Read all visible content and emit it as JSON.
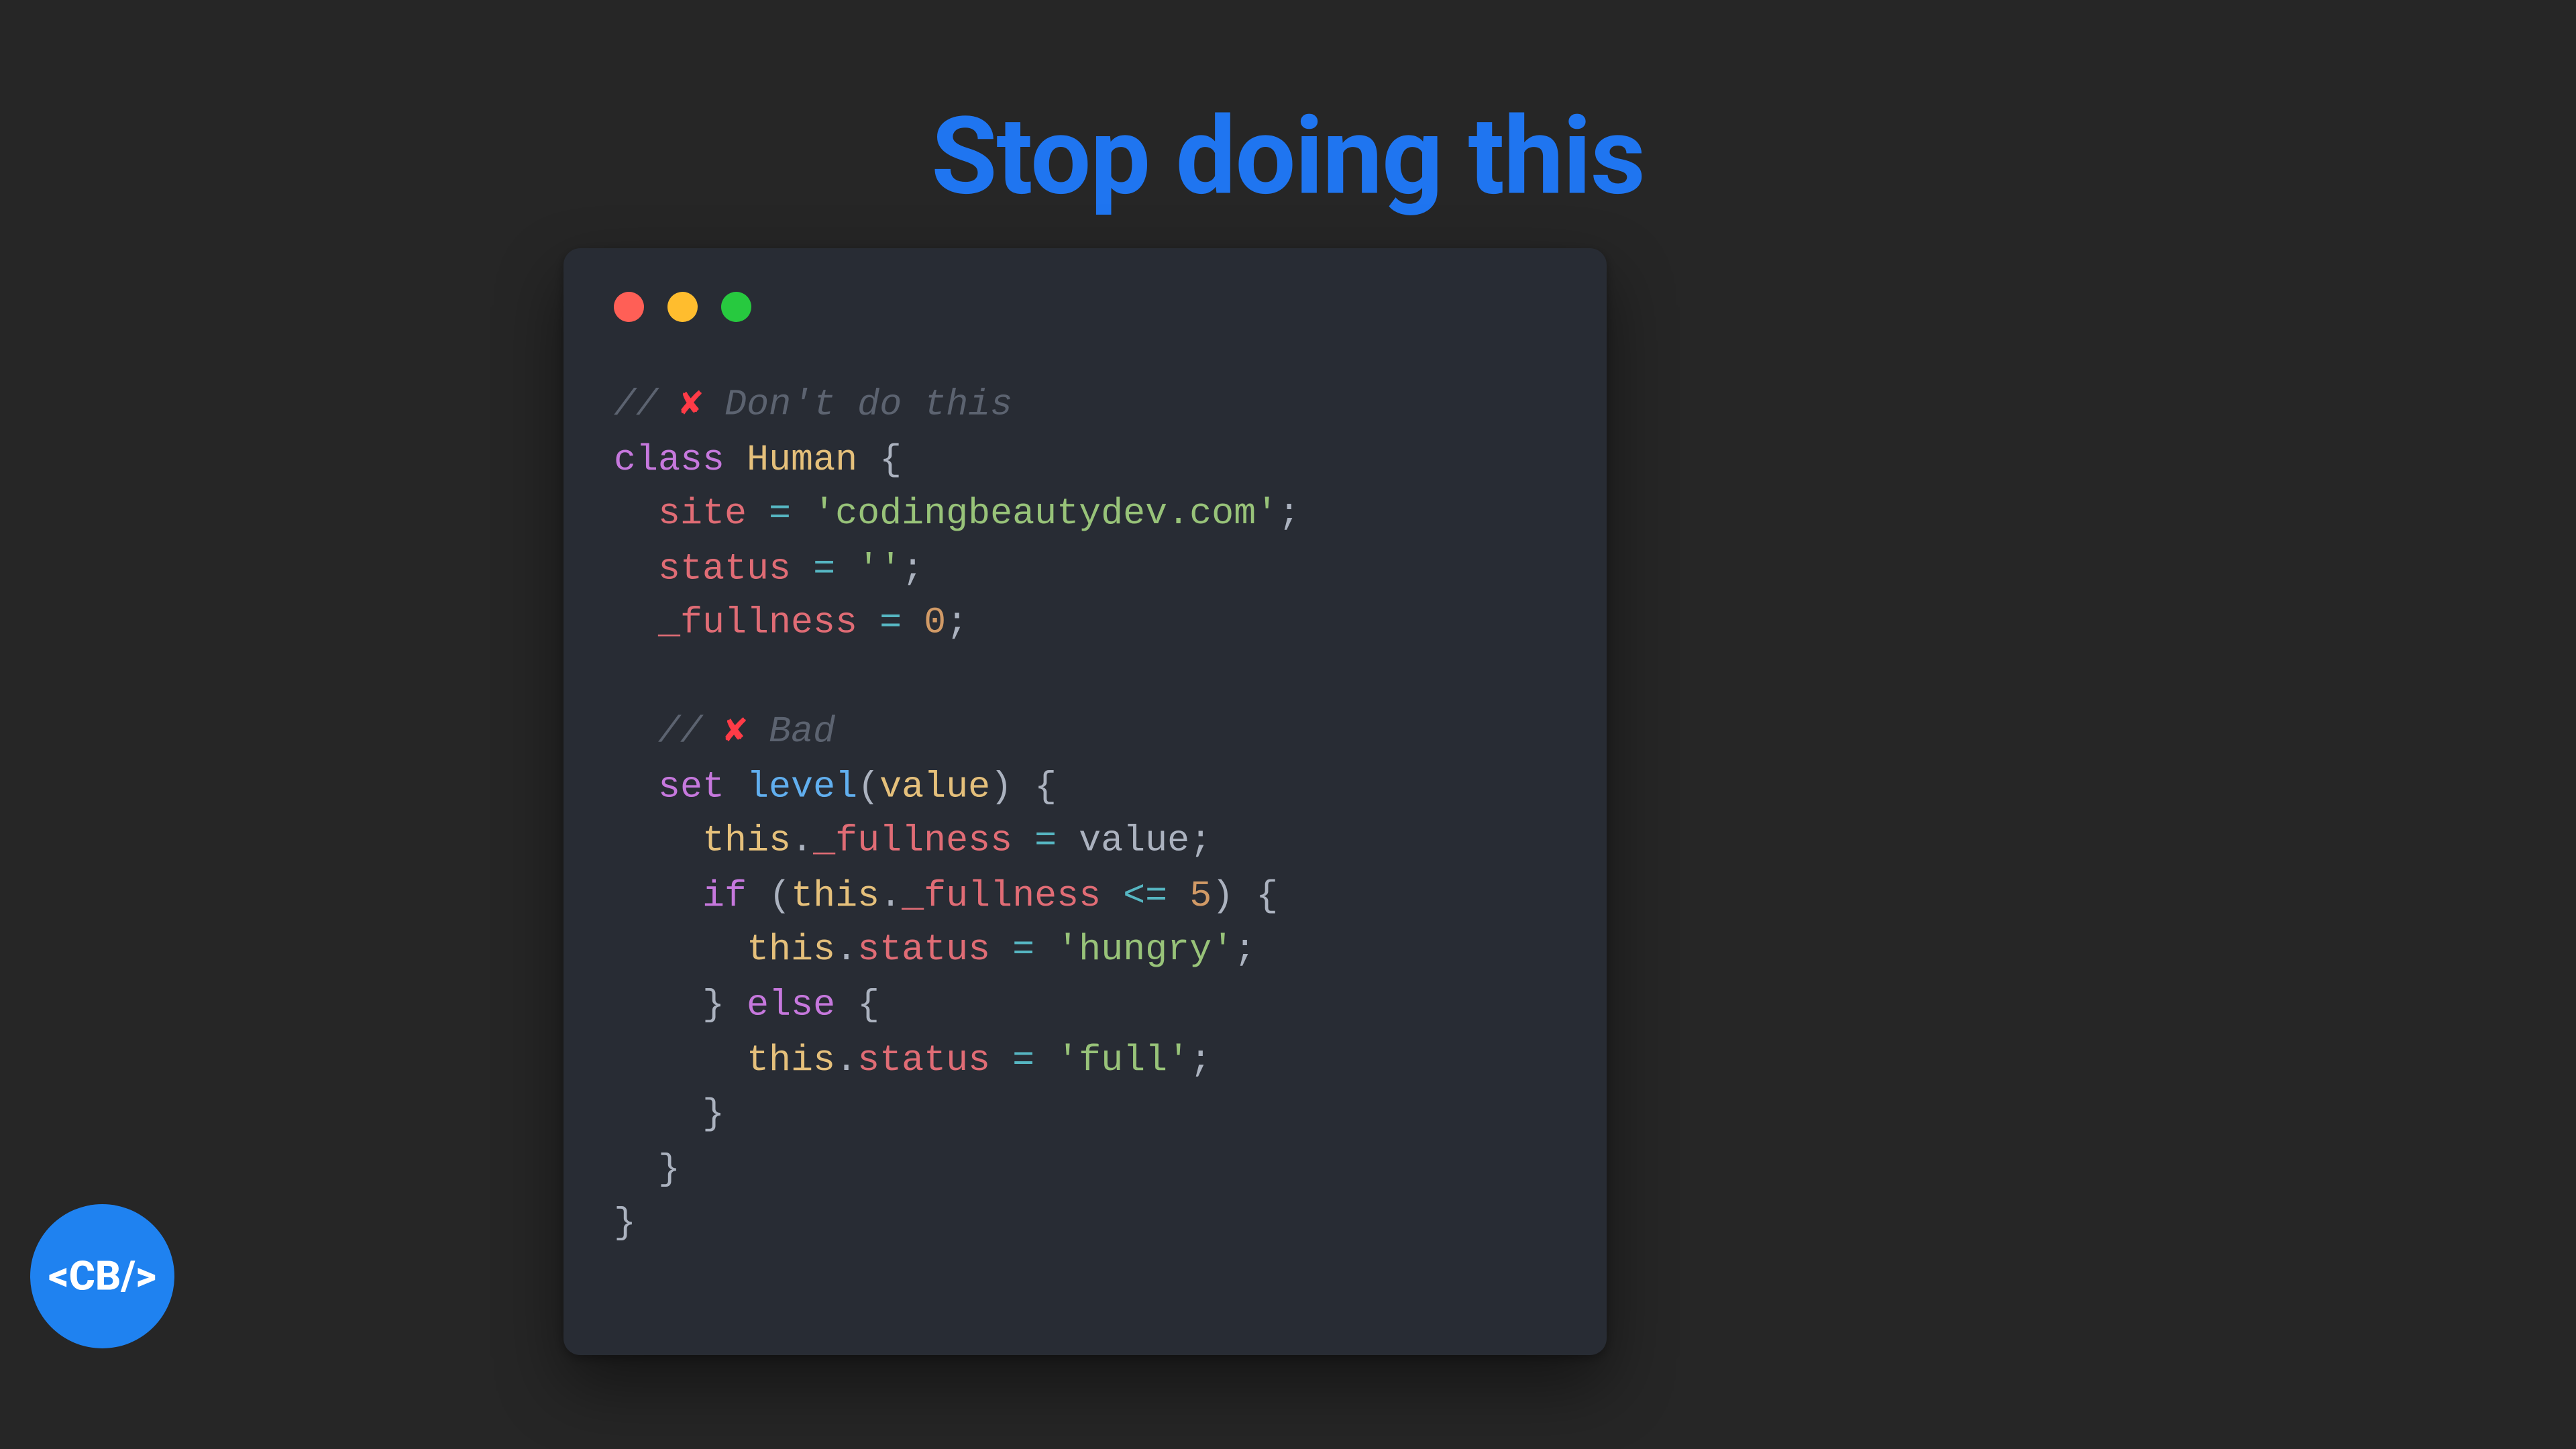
{
  "heading": "Stop doing this",
  "logo_text": "<CB/>",
  "traffic_colors": {
    "red": "#ff5f56",
    "yellow": "#ffbd2e",
    "green": "#27c93f"
  },
  "accent_color": "#1f75f0",
  "cross_glyph": "✘",
  "code": {
    "comment1_prefix": "// ",
    "comment1_text": " Don't do this",
    "kw_class": "class",
    "class_name": "Human",
    "brace_open": " {",
    "field_site": "site",
    "eq": " = ",
    "str_site": "'codingbeautydev.com'",
    "semi": ";",
    "field_status": "status",
    "str_empty": "''",
    "field_fullness": "_fullness",
    "num_zero": "0",
    "comment2_prefix": "// ",
    "comment2_text": " Bad",
    "kw_set": "set",
    "setter_name": "level",
    "paren_open": "(",
    "param_value": "value",
    "paren_close": ")",
    "this": "this",
    "dot": ".",
    "assign_value": "value",
    "kw_if": "if",
    "op_lte": "<=",
    "num_five": "5",
    "str_hungry": "'hungry'",
    "kw_else": "else",
    "str_full": "'full'",
    "brace_close": "}"
  }
}
